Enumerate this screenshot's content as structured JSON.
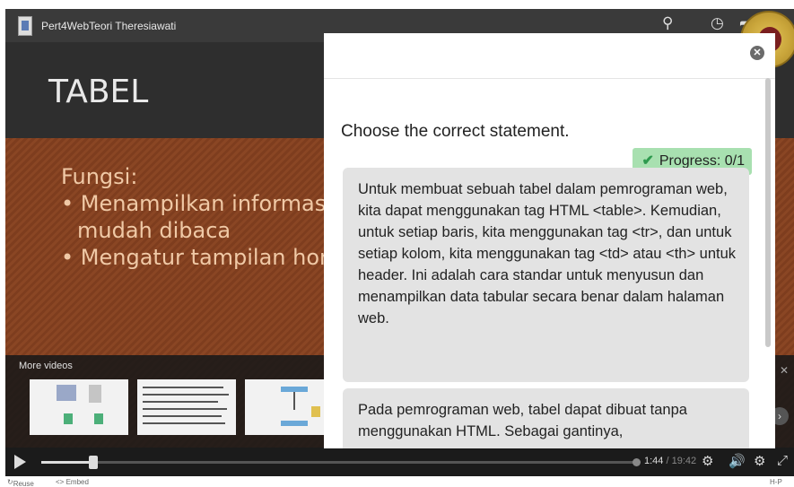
{
  "video": {
    "title": "Pert4WebTeori Theresiawati",
    "slide_title": "TABEL",
    "slide_lines": [
      "Fungsi:",
      "• Menampilkan informasi s",
      "mudah dibaca",
      "• Mengatur tampilan hom"
    ],
    "more_videos_label": "More videos",
    "time_current": "1:44",
    "time_total": "/ 19:42",
    "progress_fraction": 0.088
  },
  "footer": {
    "reuse_label": "Reuse",
    "embed_label": "<> Embed",
    "h5p_label": "H-P"
  },
  "quiz": {
    "question": "Choose the correct statement.",
    "progress_label": "Progress: 0/1",
    "answers": [
      "Untuk membuat sebuah tabel dalam pemrograman web, kita dapat menggunakan tag HTML <table>. Kemudian, untuk setiap baris, kita menggunakan tag <tr>, dan untuk setiap kolom, kita menggunakan tag <td> atau <th> untuk header. Ini adalah cara standar untuk menyusun dan menampilkan data tabular secara benar dalam halaman web.",
      "Pada pemrograman web, tabel dapat dibuat tanpa menggunakan HTML. Sebagai gantinya,"
    ]
  },
  "icons": {
    "search": "search-icon",
    "clock": "clock-icon",
    "share": "share-icon",
    "close": "close-icon",
    "check": "check-icon",
    "play": "play-icon",
    "quality": "quality-icon",
    "volume": "volume-icon",
    "settings": "settings-icon",
    "fullscreen": "fullscreen-icon"
  },
  "colors": {
    "progress_bg": "#a8e0b0",
    "check": "#2e9a4e",
    "answer_bg": "#e3e3e3",
    "slide_bg": "#8a4624"
  }
}
